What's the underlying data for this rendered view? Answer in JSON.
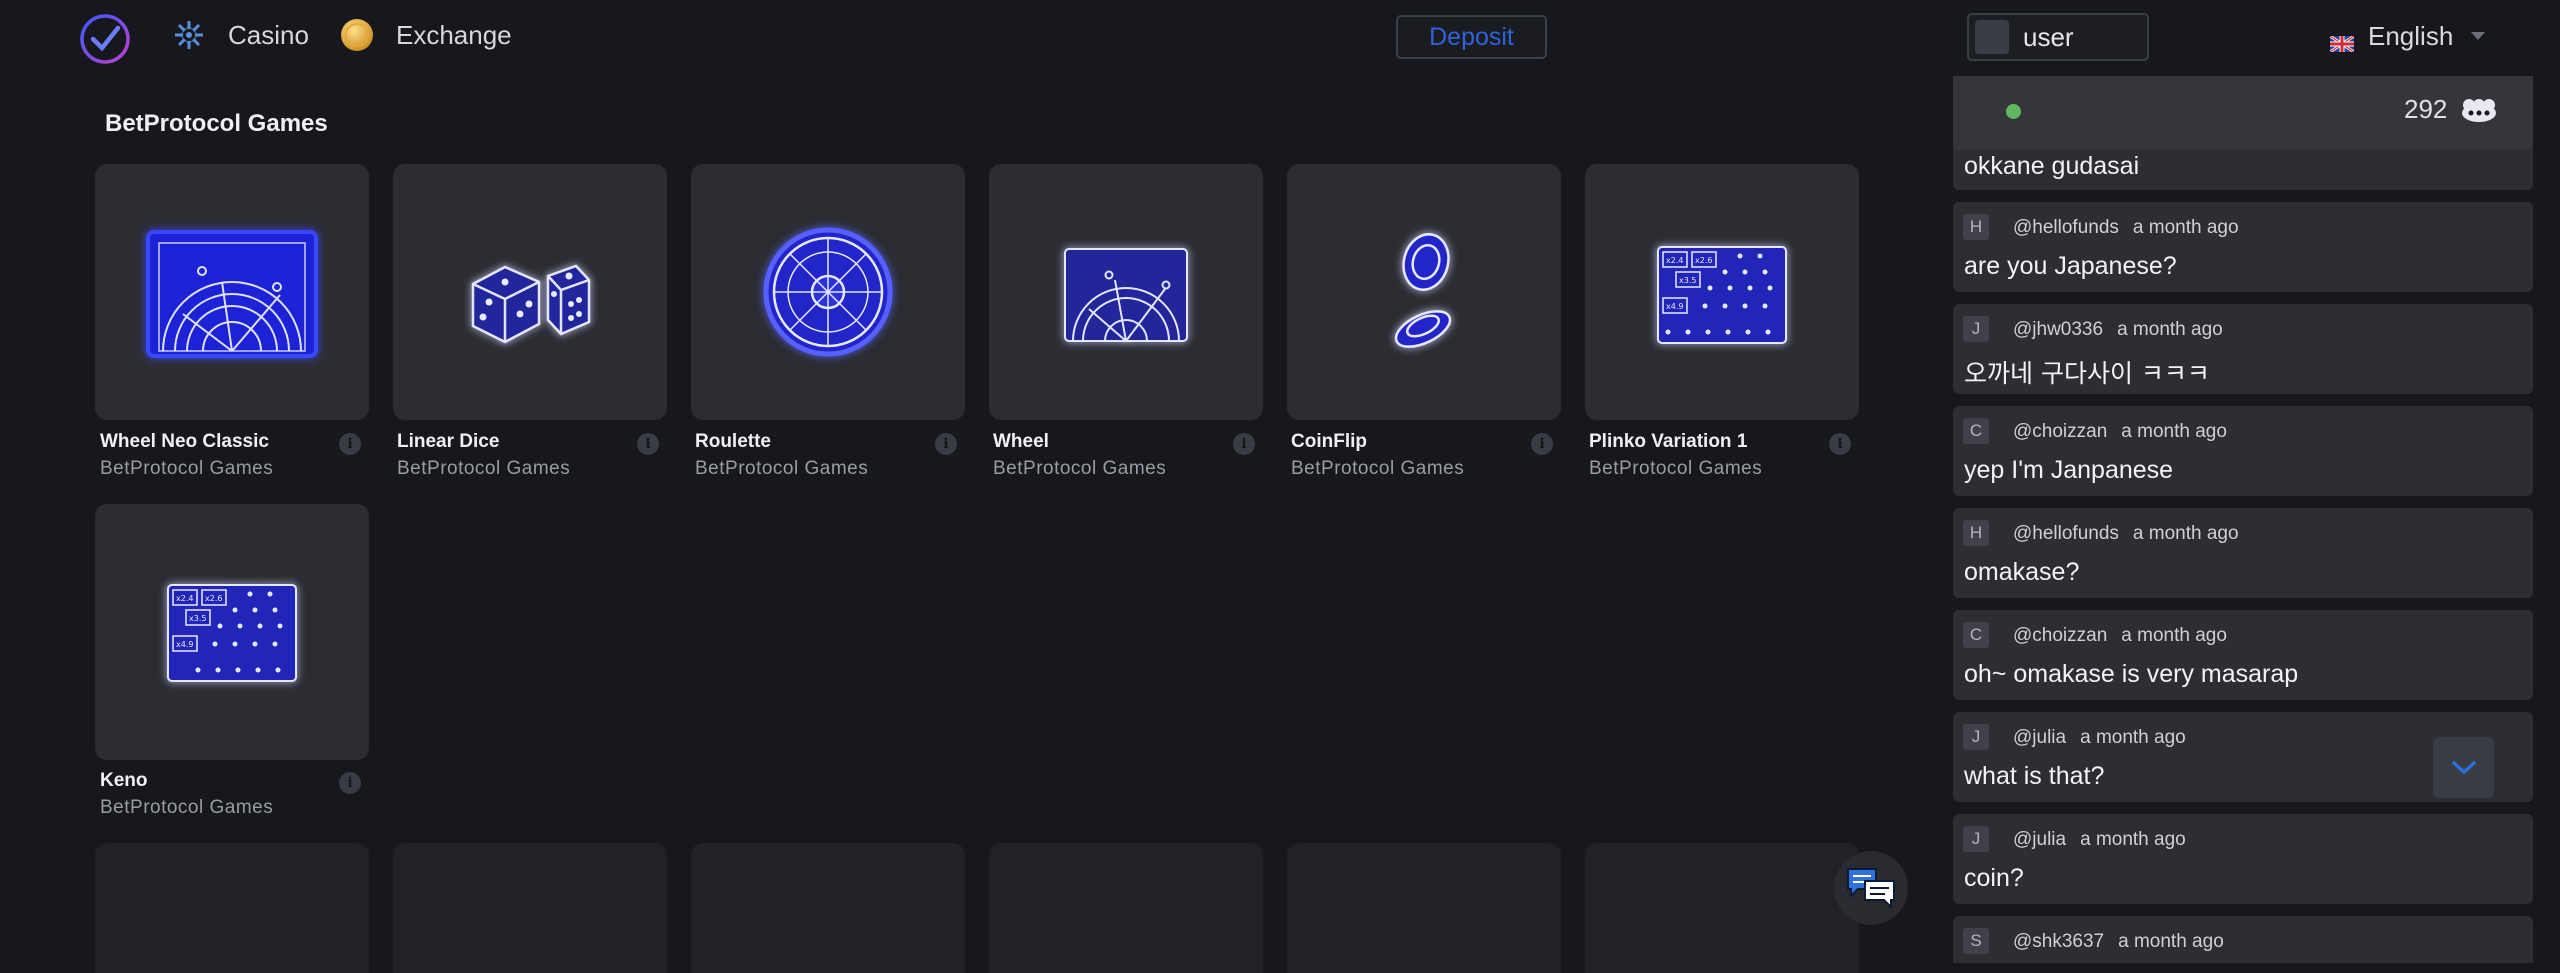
{
  "header": {
    "nav": [
      {
        "label": "Casino",
        "icon": "casino-icon"
      },
      {
        "label": "Exchange",
        "icon": "exchange-coin-icon"
      }
    ],
    "deposit_label": "Deposit",
    "user_name": "user",
    "language": "English"
  },
  "main": {
    "section_title": "BetProtocol Games",
    "games": [
      {
        "name": "Wheel Neo Classic",
        "provider": "BetProtocol Games",
        "icon": "wheel-neo-icon"
      },
      {
        "name": "Linear Dice",
        "provider": "BetProtocol Games",
        "icon": "dice-icon"
      },
      {
        "name": "Roulette",
        "provider": "BetProtocol Games",
        "icon": "roulette-icon"
      },
      {
        "name": "Wheel",
        "provider": "BetProtocol Games",
        "icon": "wheel-icon"
      },
      {
        "name": "CoinFlip",
        "provider": "BetProtocol Games",
        "icon": "coinflip-icon"
      },
      {
        "name": "Plinko Variation 1",
        "provider": "BetProtocol Games",
        "icon": "plinko-icon"
      },
      {
        "name": "Keno",
        "provider": "BetProtocol Games",
        "icon": "keno-icon"
      }
    ],
    "multiplier_tiles": [
      "x2.4",
      "x2.6",
      "x3.5",
      "x4.9"
    ]
  },
  "chat": {
    "online_count": "292",
    "first_message": "okkane gudasai",
    "messages": [
      {
        "initial": "H",
        "user": "@hellofunds",
        "time": "a month ago",
        "text": "are you Japanese?"
      },
      {
        "initial": "J",
        "user": "@jhw0336",
        "time": "a month ago",
        "text": "오까네 구다사이 ㅋㅋㅋ"
      },
      {
        "initial": "C",
        "user": "@choizzan",
        "time": "a month ago",
        "text": "yep I'm Janpanese"
      },
      {
        "initial": "H",
        "user": "@hellofunds",
        "time": "a month ago",
        "text": "omakase?"
      },
      {
        "initial": "C",
        "user": "@choizzan",
        "time": "a month ago",
        "text": "oh~ omakase is very masarap"
      },
      {
        "initial": "J",
        "user": "@julia",
        "time": "a month ago",
        "text": "what is that?"
      },
      {
        "initial": "J",
        "user": "@julia",
        "time": "a month ago",
        "text": "coin?"
      },
      {
        "initial": "S",
        "user": "@shk3637",
        "time": "a month ago",
        "text": ""
      }
    ]
  },
  "colors": {
    "background": "#17181d",
    "card": "#2c2d33",
    "neon_blue": "#2d2dff",
    "deposit_text": "#2f63d8",
    "online_dot": "#5fb85d"
  }
}
